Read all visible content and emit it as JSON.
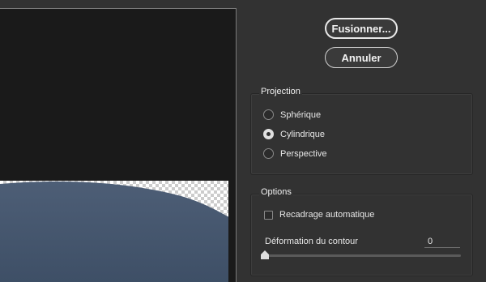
{
  "buttons": {
    "merge_label": "Fusionner...",
    "cancel_label": "Annuler"
  },
  "projection": {
    "title": "Projection",
    "options": [
      {
        "label": "Sphérique",
        "checked": false
      },
      {
        "label": "Cylindrique",
        "checked": true
      },
      {
        "label": "Perspective",
        "checked": false
      }
    ]
  },
  "options": {
    "title": "Options",
    "auto_crop_label": "Recadrage automatique",
    "auto_crop_checked": false,
    "boundary_warp_label": "Déformation du contour",
    "boundary_warp_value": "0",
    "boundary_warp_level": 0
  },
  "colors": {
    "sky": "#4a5b72",
    "background": "#323232"
  }
}
